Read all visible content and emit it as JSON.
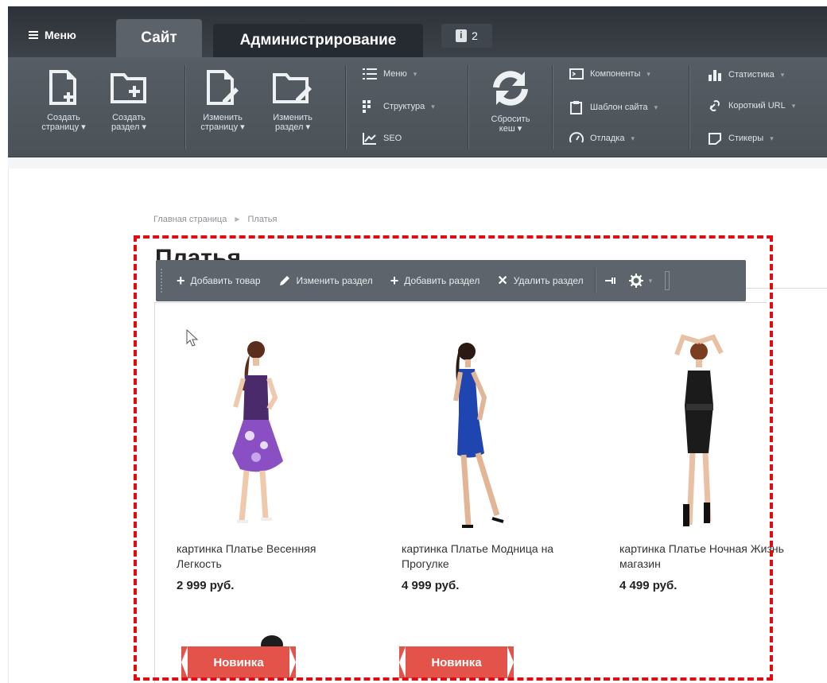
{
  "admin_panel": {
    "menu_label": "Меню",
    "tabs": [
      {
        "label": "Сайт",
        "active": true
      },
      {
        "label": "Администрирование",
        "active": false
      }
    ],
    "notifications_count": "2",
    "toolbar": {
      "create_page": [
        "Создать",
        "страницу ▾"
      ],
      "create_section": [
        "Создать",
        "раздел ▾"
      ],
      "edit_page": [
        "Изменить",
        "страницу ▾"
      ],
      "edit_section": [
        "Изменить",
        "раздел ▾"
      ],
      "menu": "Меню",
      "structure": "Структура",
      "seo": "SEO",
      "reset_cache": [
        "Сбросить",
        "кеш ▾"
      ],
      "components": "Компоненты",
      "site_template": "Шаблон сайта",
      "debug": "Отладка",
      "statistics": "Статистика",
      "short_url": "Короткий URL",
      "stickers": "Стикеры"
    }
  },
  "breadcrumb": [
    "Главная страница",
    "Платья"
  ],
  "page_title": "Платья",
  "edit_bar": {
    "add_product": "Добавить товар",
    "edit_section": "Изменить раздел",
    "add_section": "Добавить раздел",
    "delete_section": "Удалить раздел"
  },
  "products": [
    {
      "name": "картинка Платье Весенняя Легкость",
      "price": "2 999 руб."
    },
    {
      "name": "картинка Платье Модница на Прогулке",
      "price": "4 999 руб."
    },
    {
      "name": "картинка Платье Ночная Жизнь магазин",
      "price": "4 499 руб."
    }
  ],
  "badges": [
    "Новинка",
    "Новинка"
  ],
  "colors": {
    "accent_red": "#e10c12",
    "panel_dark": "#3c4248",
    "badge": "#e4534a"
  }
}
